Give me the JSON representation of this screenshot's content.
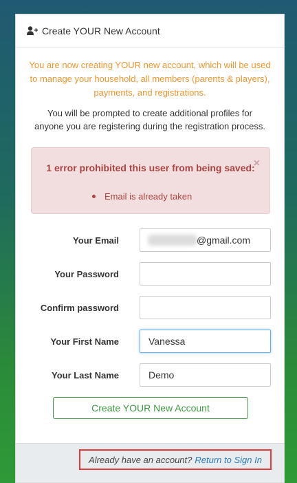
{
  "header": {
    "icon": "user-plus-icon",
    "title": "Create YOUR New Account"
  },
  "intro": {
    "orange_text": "You are now creating YOUR new account, which will be used to manage your household, all members (parents & players), payments, and registrations.",
    "dark_text": "You will be prompted to create additional profiles for anyone you are registering during the registration process."
  },
  "alert": {
    "title": "1 error prohibited this user from being saved:",
    "close": "×",
    "errors": [
      "Email is already taken"
    ],
    "color": "#a94442"
  },
  "form": {
    "email_label": "Your Email",
    "email_value_visible": "@gmail.com",
    "password_label": "Your Password",
    "confirm_label": "Confirm password",
    "first_name_label": "Your First Name",
    "first_name_value": "Vanessa",
    "last_name_label": "Your Last Name",
    "last_name_value": "Demo",
    "submit_label": "Create YOUR New Account"
  },
  "footer": {
    "prompt": "Already have an account?",
    "link": "Return to Sign In"
  },
  "colors": {
    "orange": "#f0962e",
    "green": "#3c9a3f",
    "link": "#2a7ab8",
    "highlight": "#e03a3a"
  }
}
